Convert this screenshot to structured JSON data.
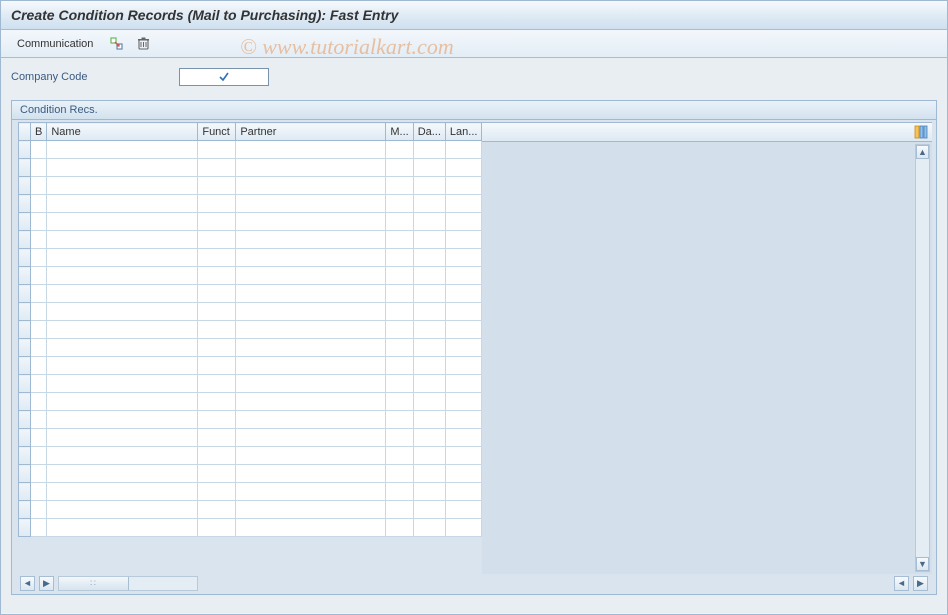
{
  "title": "Create Condition Records (Mail to Purchasing): Fast Entry",
  "toolbar": {
    "communication_label": "Communication"
  },
  "fields": {
    "company_code_label": "Company Code",
    "company_code_value": ""
  },
  "groupbox": {
    "label": "Condition Recs."
  },
  "columns": {
    "b": "B",
    "name": "Name",
    "funct": "Funct",
    "partner": "Partner",
    "m": "M...",
    "da": "Da...",
    "lan": "Lan..."
  },
  "rows": [
    {
      "b": "",
      "name": "",
      "funct": "",
      "partner": "",
      "m": "",
      "da": "",
      "lan": ""
    },
    {
      "b": "",
      "name": "",
      "funct": "",
      "partner": "",
      "m": "",
      "da": "",
      "lan": ""
    },
    {
      "b": "",
      "name": "",
      "funct": "",
      "partner": "",
      "m": "",
      "da": "",
      "lan": ""
    },
    {
      "b": "",
      "name": "",
      "funct": "",
      "partner": "",
      "m": "",
      "da": "",
      "lan": ""
    },
    {
      "b": "",
      "name": "",
      "funct": "",
      "partner": "",
      "m": "",
      "da": "",
      "lan": ""
    },
    {
      "b": "",
      "name": "",
      "funct": "",
      "partner": "",
      "m": "",
      "da": "",
      "lan": ""
    },
    {
      "b": "",
      "name": "",
      "funct": "",
      "partner": "",
      "m": "",
      "da": "",
      "lan": ""
    },
    {
      "b": "",
      "name": "",
      "funct": "",
      "partner": "",
      "m": "",
      "da": "",
      "lan": ""
    },
    {
      "b": "",
      "name": "",
      "funct": "",
      "partner": "",
      "m": "",
      "da": "",
      "lan": ""
    },
    {
      "b": "",
      "name": "",
      "funct": "",
      "partner": "",
      "m": "",
      "da": "",
      "lan": ""
    },
    {
      "b": "",
      "name": "",
      "funct": "",
      "partner": "",
      "m": "",
      "da": "",
      "lan": ""
    },
    {
      "b": "",
      "name": "",
      "funct": "",
      "partner": "",
      "m": "",
      "da": "",
      "lan": ""
    },
    {
      "b": "",
      "name": "",
      "funct": "",
      "partner": "",
      "m": "",
      "da": "",
      "lan": ""
    },
    {
      "b": "",
      "name": "",
      "funct": "",
      "partner": "",
      "m": "",
      "da": "",
      "lan": ""
    },
    {
      "b": "",
      "name": "",
      "funct": "",
      "partner": "",
      "m": "",
      "da": "",
      "lan": ""
    },
    {
      "b": "",
      "name": "",
      "funct": "",
      "partner": "",
      "m": "",
      "da": "",
      "lan": ""
    },
    {
      "b": "",
      "name": "",
      "funct": "",
      "partner": "",
      "m": "",
      "da": "",
      "lan": ""
    },
    {
      "b": "",
      "name": "",
      "funct": "",
      "partner": "",
      "m": "",
      "da": "",
      "lan": ""
    },
    {
      "b": "",
      "name": "",
      "funct": "",
      "partner": "",
      "m": "",
      "da": "",
      "lan": ""
    },
    {
      "b": "",
      "name": "",
      "funct": "",
      "partner": "",
      "m": "",
      "da": "",
      "lan": ""
    },
    {
      "b": "",
      "name": "",
      "funct": "",
      "partner": "",
      "m": "",
      "da": "",
      "lan": ""
    },
    {
      "b": "",
      "name": "",
      "funct": "",
      "partner": "",
      "m": "",
      "da": "",
      "lan": ""
    }
  ],
  "watermark": "© www.tutorialkart.com"
}
